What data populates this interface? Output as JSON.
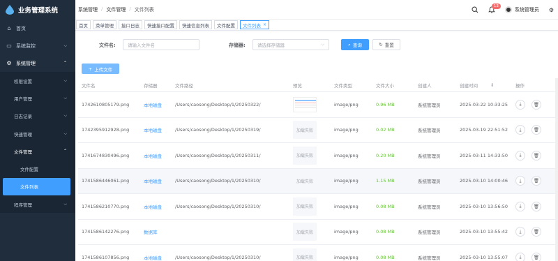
{
  "app": {
    "title": "业务管理系统"
  },
  "sidebar": {
    "items": [
      {
        "label": "首页",
        "icon": "home-icon"
      },
      {
        "label": "系统监控",
        "icon": "monitor-icon"
      },
      {
        "label": "系统管理",
        "icon": "gear-icon"
      }
    ],
    "sub": [
      {
        "label": "权限设置"
      },
      {
        "label": "用户管理"
      },
      {
        "label": "日志记录"
      },
      {
        "label": "快速管理"
      },
      {
        "label": "文件管理"
      }
    ],
    "sub2": [
      {
        "label": "文件配置"
      },
      {
        "label": "文件列表"
      }
    ],
    "program": {
      "label": "程序管理"
    }
  },
  "navbar": {
    "breadcrumb": [
      "系统管理",
      "文件管理",
      "文件列表"
    ],
    "badge": "13",
    "user": "系统管理员"
  },
  "tags": [
    {
      "label": "首页"
    },
    {
      "label": "菜单管理"
    },
    {
      "label": "接口日志"
    },
    {
      "label": "快速接口配置"
    },
    {
      "label": "快速信息列表"
    },
    {
      "label": "文件配置"
    },
    {
      "label": "文件列表"
    }
  ],
  "search": {
    "filename_label": "文件名:",
    "filename_placeholder": "请输入文件名",
    "storage_label": "存储器:",
    "storage_placeholder": "请选择存储器",
    "query": "查询",
    "reset": "重置"
  },
  "upload": "上传文件",
  "table": {
    "headers": [
      "文件名",
      "存储器",
      "文件路径",
      "预览",
      "文件类型",
      "文件大小",
      "创建人",
      "创建时间",
      "操作"
    ],
    "rows": [
      {
        "name": "1742610805179.png",
        "storage": "本地磁盘",
        "path": "/Users/caosong/Desktop/1/20250322/",
        "preview": "",
        "type": "image/png",
        "size": "0.96 MB",
        "creator": "系统管理员",
        "time": "2025-03-22 10:33:25"
      },
      {
        "name": "1742395912928.png",
        "storage": "本地磁盘",
        "path": "/Users/caosong/Desktop/1/20250319/",
        "preview": "加载失败",
        "type": "image/png",
        "size": "0.02 MB",
        "creator": "系统管理员",
        "time": "2025-03-19 22:51:52"
      },
      {
        "name": "1741674830496.png",
        "storage": "本地磁盘",
        "path": "/Users/caosong/Desktop/1/20250311/",
        "preview": "加载失败",
        "type": "image/png",
        "size": "0.20 MB",
        "creator": "系统管理员",
        "time": "2025-03-11 14:33:50"
      },
      {
        "name": "1741586446061.png",
        "storage": "本地磁盘",
        "path": "/Users/caosong/Desktop/1/20250310/",
        "preview": "加载失败",
        "type": "image/png",
        "size": "1.15 MB",
        "creator": "系统管理员",
        "time": "2025-03-10 14:00:46"
      },
      {
        "name": "1741586210770.png",
        "storage": "本地磁盘",
        "path": "/Users/caosong/Desktop/1/20250310/",
        "preview": "加载失败",
        "type": "image/png",
        "size": "0.08 MB",
        "creator": "系统管理员",
        "time": "2025-03-10 13:56:50"
      },
      {
        "name": "1741586142276.png",
        "storage": "数据库",
        "path": "",
        "preview": "加载失败",
        "type": "image/png",
        "size": "0.08 MB",
        "creator": "系统管理员",
        "time": "2025-03-10 13:55:42"
      },
      {
        "name": "1741586107856.png",
        "storage": "本地磁盘",
        "path": "/Users/caosong/Desktop/1/20250310/",
        "preview": "加载失败",
        "type": "image/png",
        "size": "0.08 MB",
        "creator": "系统管理员",
        "time": "2025-03-10 13:55:07"
      }
    ]
  },
  "colors": {
    "sidebar": "#1f2d3d",
    "accent": "#409eff",
    "size_green": "#67c23a"
  }
}
